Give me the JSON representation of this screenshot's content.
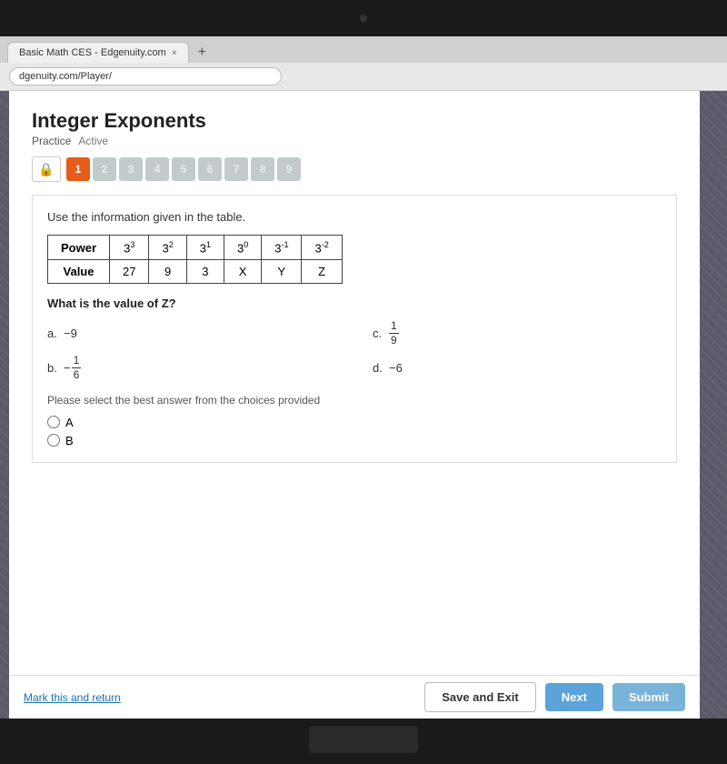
{
  "browser": {
    "tab_label": "Basic Math CES - Edgenuity.com",
    "tab_close": "×",
    "tab_add": "+",
    "address": "dgenuity.com/Player/"
  },
  "page": {
    "title": "Integer Exponents",
    "practice_label": "Practice",
    "active_label": "Active"
  },
  "question_numbers": {
    "current": "1",
    "others": [
      "2",
      "3",
      "4",
      "5",
      "6",
      "7",
      "8",
      "9"
    ]
  },
  "lock_icon": "🔒",
  "question": {
    "instruction": "Use the information given in the table.",
    "table": {
      "row1_header": "Power",
      "row2_header": "Value",
      "columns": [
        {
          "power": "3³",
          "value": "27"
        },
        {
          "power": "3²",
          "value": "9"
        },
        {
          "power": "3¹",
          "value": "3"
        },
        {
          "power": "3⁰",
          "value": "X"
        },
        {
          "power": "3⁻¹",
          "value": "Y"
        },
        {
          "power": "3⁻²",
          "value": "Z"
        }
      ]
    },
    "question_text": "What is the value of Z?",
    "options": [
      {
        "label": "a.",
        "value": "−9"
      },
      {
        "label": "c.",
        "value_frac": true,
        "num": "1",
        "den": "9"
      },
      {
        "label": "b.",
        "value_neg_frac": true,
        "num": "1",
        "den": "6"
      },
      {
        "label": "d.",
        "value": "−6"
      }
    ],
    "select_message": "Please select the best answer from the choices provided",
    "radio_options": [
      {
        "label": "A"
      },
      {
        "label": "B"
      }
    ]
  },
  "bottom": {
    "mark_return": "Mark this and return",
    "save_exit": "Save and Exit",
    "next": "Next",
    "submit": "Submit"
  }
}
